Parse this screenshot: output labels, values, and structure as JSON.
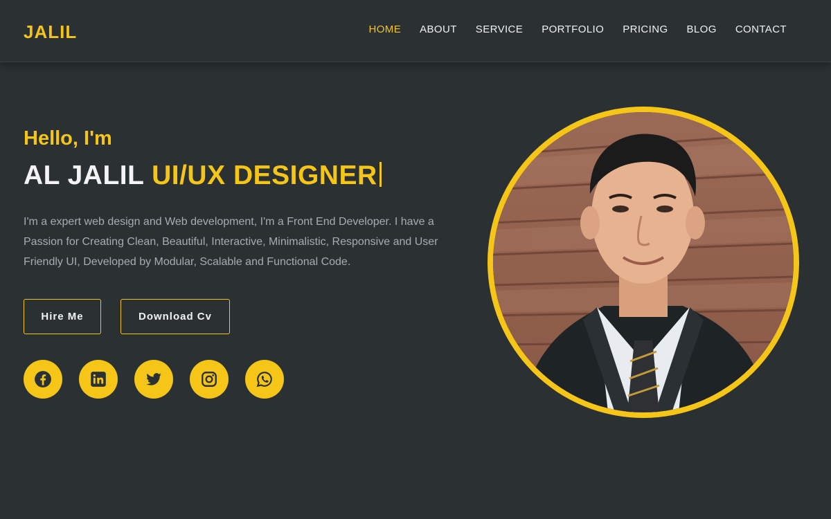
{
  "brand": {
    "logo": "JALIL",
    "accent_color": "#f5c518"
  },
  "nav": {
    "items": [
      {
        "label": "HOME",
        "active": true
      },
      {
        "label": "ABOUT"
      },
      {
        "label": "SERVICE"
      },
      {
        "label": "PORTFOLIO"
      },
      {
        "label": "PRICING"
      },
      {
        "label": "BLOG"
      },
      {
        "label": "CONTACT"
      }
    ]
  },
  "hero": {
    "greeting": "Hello, I'm",
    "name": "AL JALIL",
    "role": "UI/UX DESIGNER",
    "description": "I'm a expert web design and Web development, I'm a Front End Developer. I have a Passion for Creating Clean, Beautiful, Interactive, Minimalistic, Responsive and User Friendly UI, Developed by Modular, Scalable and Functional Code.",
    "buttons": {
      "hire": "Hire Me",
      "cv": "Download Cv"
    },
    "socials": [
      "facebook-icon",
      "linkedin-icon",
      "twitter-icon",
      "instagram-icon",
      "whatsapp-icon"
    ]
  }
}
